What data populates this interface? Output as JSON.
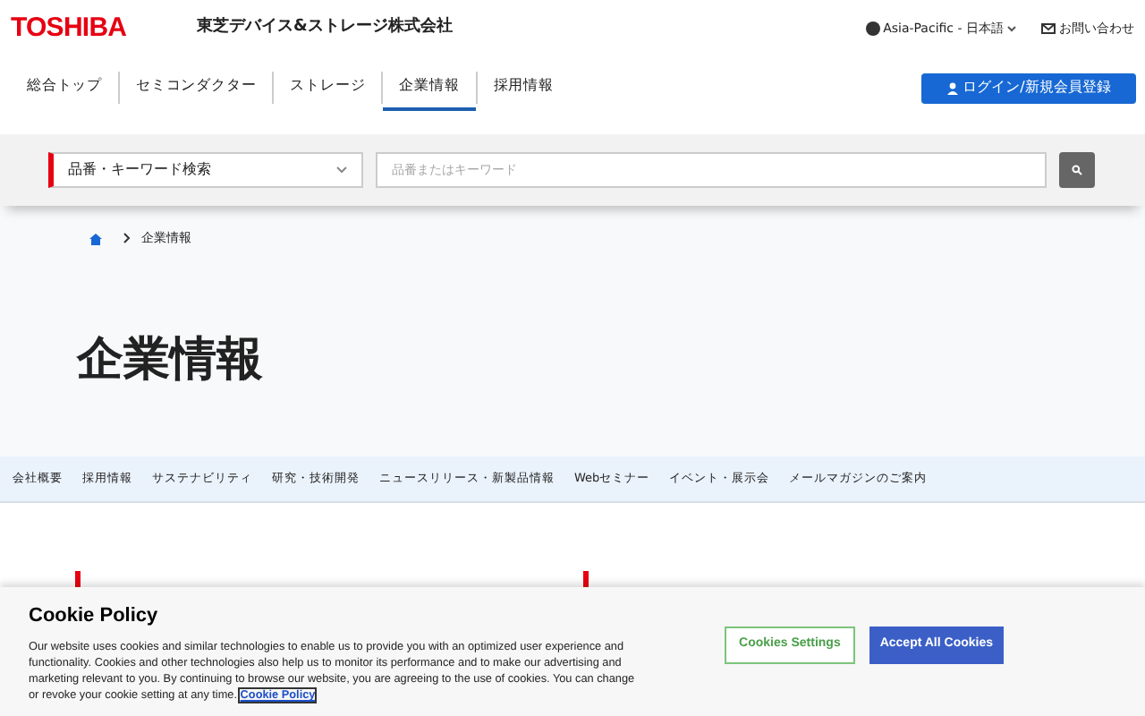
{
  "header": {
    "logo": "TOSHIBA",
    "company": "東芝デバイス&ストレージ株式会社",
    "region": "Asia-Pacific - 日本語",
    "contact": "お問い合わせ"
  },
  "nav": [
    {
      "label": "総合トップ",
      "selected": false
    },
    {
      "label": "セミコンダクター",
      "selected": false
    },
    {
      "label": "ストレージ",
      "selected": false
    },
    {
      "label": "企業情報",
      "selected": true
    },
    {
      "label": "採用情報",
      "selected": false
    }
  ],
  "login_button": "ログイン/新規会員登録",
  "search": {
    "category": "品番・キーワード検索",
    "placeholder": "品番またはキーワード"
  },
  "breadcrumb": [
    "企業情報"
  ],
  "page_title": "企業情報",
  "subnav": [
    "会社概要",
    "採用情報",
    "サステナビリティ",
    "研究・技術開発",
    "ニュースリリース・新製品情報",
    "Webセミナー",
    "イベント・展示会",
    "メールマガジンのご案内"
  ],
  "sections": [
    {
      "kind": "heading"
    },
    {
      "kind": "heading"
    }
  ],
  "cookie": {
    "title": "Cookie Policy",
    "text": "Our website uses cookies and similar technologies to enable us to provide you with an optimized user experience and functionality. Cookies and other technologies also help us to monitor its performance and to make our advertising and marketing relevant to you. By continuing to browse our website, you are agreeing to the use of cookies. You can change or revoke your cookie setting at any time.",
    "link": "Cookie Policy",
    "settings_button": "Cookies Settings",
    "accept_button": "Accept All Cookies"
  }
}
